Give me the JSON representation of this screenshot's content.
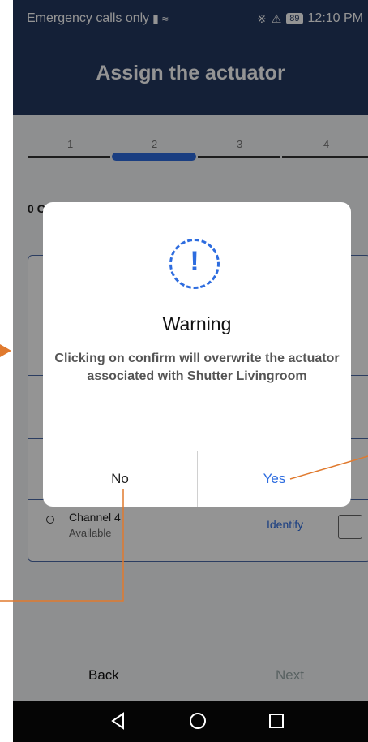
{
  "status_bar": {
    "carrier": "Emergency calls only",
    "battery": "89",
    "time": "12:10 PM"
  },
  "app_bar": {
    "title": "Assign the actuator"
  },
  "stepper": {
    "steps": [
      "1",
      "2",
      "3",
      "4"
    ],
    "active_step": 2
  },
  "section_label": "0 C",
  "channel_row": {
    "name": "Channel 4",
    "status": "Available",
    "identify_label": "Identify"
  },
  "bottom": {
    "back_label": "Back",
    "next_label": "Next"
  },
  "dialog": {
    "icon": "exclamation-icon",
    "title": "Warning",
    "message": "Clicking on confirm will overwrite the actuator associated with Shutter Livingroom",
    "no_label": "No",
    "yes_label": "Yes"
  },
  "colors": {
    "header": "#24375f",
    "accent": "#2d6cdf",
    "annotation": "#e07a2e"
  }
}
